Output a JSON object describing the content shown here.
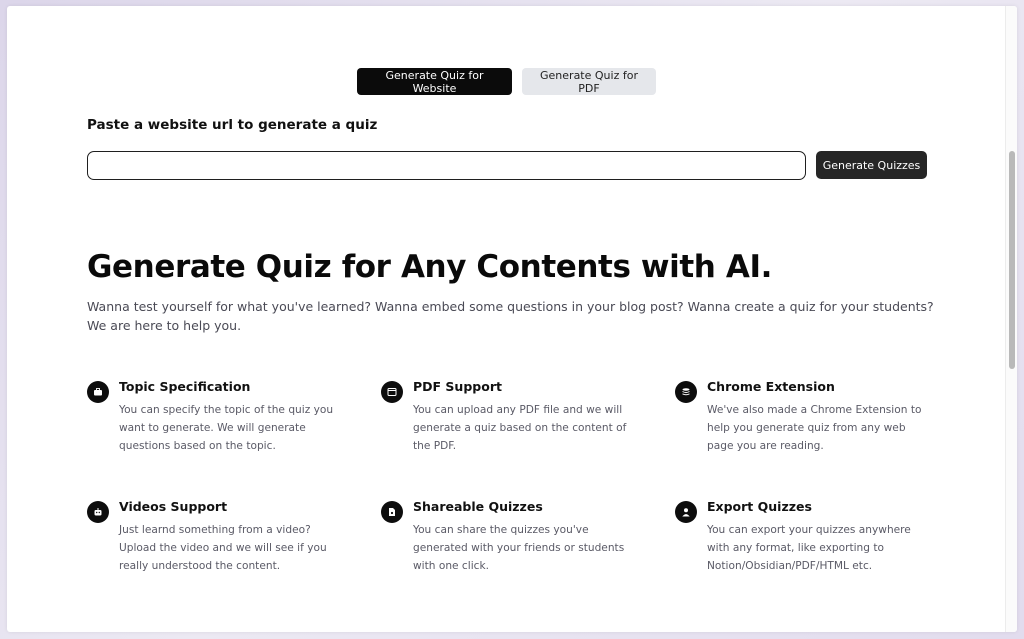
{
  "tabs": [
    {
      "label": "Generate Quiz for Website",
      "active": true
    },
    {
      "label": "Generate Quiz for PDF",
      "active": false
    }
  ],
  "form": {
    "label": "Paste a website url to generate a quiz",
    "url_value": "",
    "url_placeholder": "",
    "submit_label": "Generate Quizzes"
  },
  "hero": {
    "title": "Generate Quiz for Any Contents with AI.",
    "description": "Wanna test yourself for what you've learned? Wanna embed some questions in your blog post? Wanna create a quiz for your students? We are here to help you."
  },
  "features": [
    {
      "title": "Topic Specification",
      "description": "You can specify the topic of the quiz you want to generate. We will generate questions based on the topic.",
      "icon": "briefcase-icon"
    },
    {
      "title": "PDF Support",
      "description": "You can upload any PDF file and we will generate a quiz based on the content of the PDF.",
      "icon": "window-icon"
    },
    {
      "title": "Chrome Extension",
      "description": "We've also made a Chrome Extension to help you generate quiz from any web page you are reading.",
      "icon": "stack-icon"
    },
    {
      "title": "Videos Support",
      "description": "Just learnd something from a video? Upload the video and we will see if you really understood the content.",
      "icon": "robot-icon"
    },
    {
      "title": "Shareable Quizzes",
      "description": "You can share the quizzes you've generated with your friends or students with one click.",
      "icon": "document-icon"
    },
    {
      "title": "Export Quizzes",
      "description": "You can export your quizzes anywhere with any format, like exporting to Notion/Obsidian/PDF/HTML etc.",
      "icon": "user-icon"
    }
  ],
  "colors": {
    "primary_button": "#0b0b0b",
    "secondary_button": "#e5e7eb",
    "submit_button": "#262626",
    "body_text": "#4a4a55"
  }
}
